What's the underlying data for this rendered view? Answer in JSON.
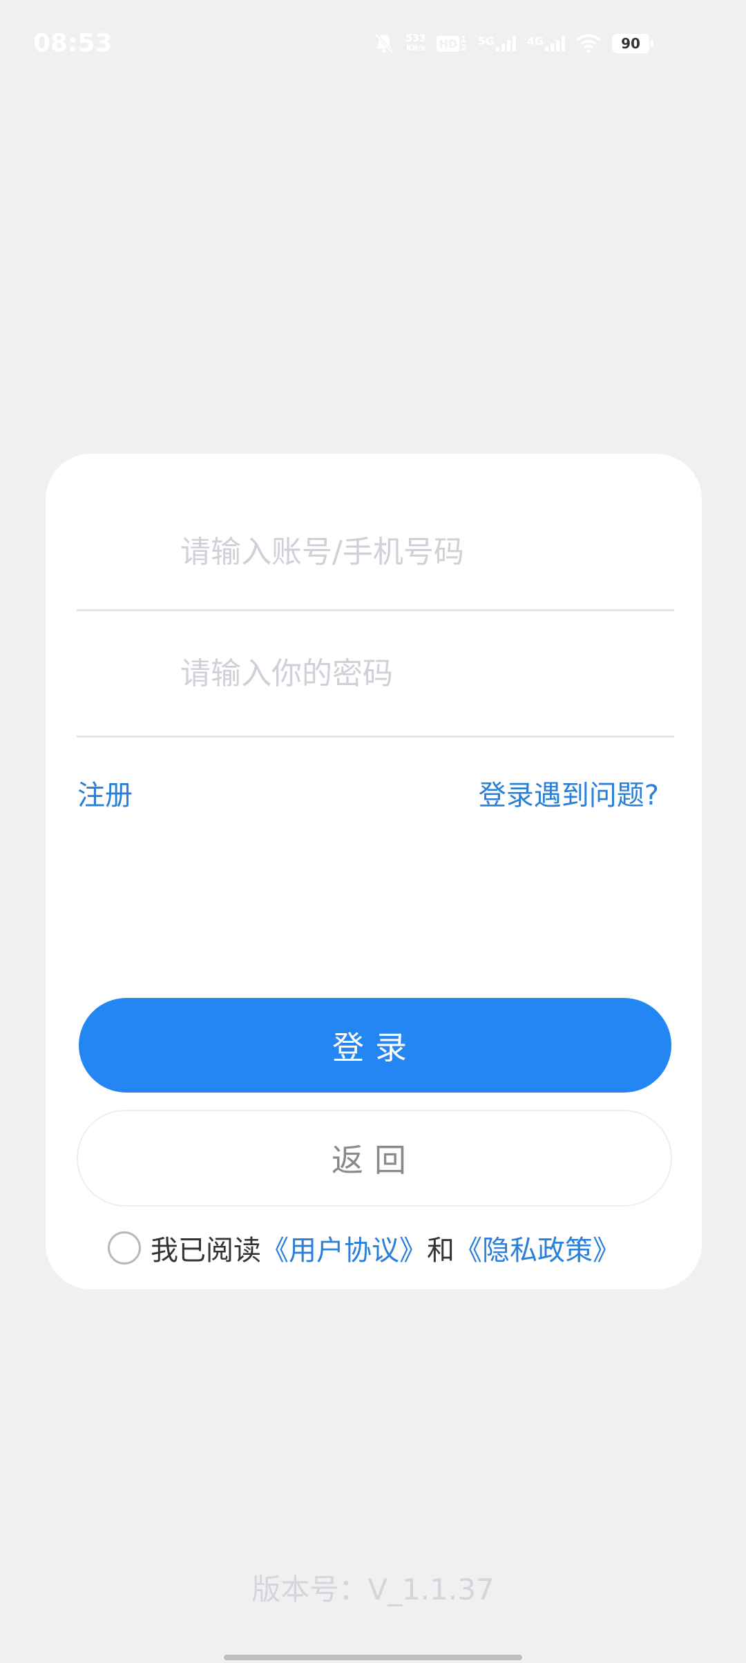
{
  "status_bar": {
    "time": "08:53",
    "net_speed_value": "533",
    "net_speed_unit": "KB/s",
    "hd_label": "HD",
    "hd_sup": "1",
    "hd_sub": "2",
    "signal_5g": "5G",
    "signal_4g": "4G",
    "battery": "90"
  },
  "form": {
    "account_placeholder": "请输入账号/手机号码",
    "password_placeholder": "请输入你的密码",
    "register_label": "注册",
    "login_problem_label": "登录遇到问题?",
    "login_button": "登录",
    "back_button": "返回"
  },
  "agreement": {
    "prefix": "我已阅读",
    "user_agreement": "《用户协议》",
    "conjunction": "和",
    "privacy_policy": "《隐私政策》",
    "checked": false
  },
  "footer": {
    "version": "版本号：V_1.1.37"
  },
  "colors": {
    "accent": "#2386f2",
    "link": "#2a7fd8",
    "background": "#f0f0f0",
    "card": "#ffffff"
  }
}
